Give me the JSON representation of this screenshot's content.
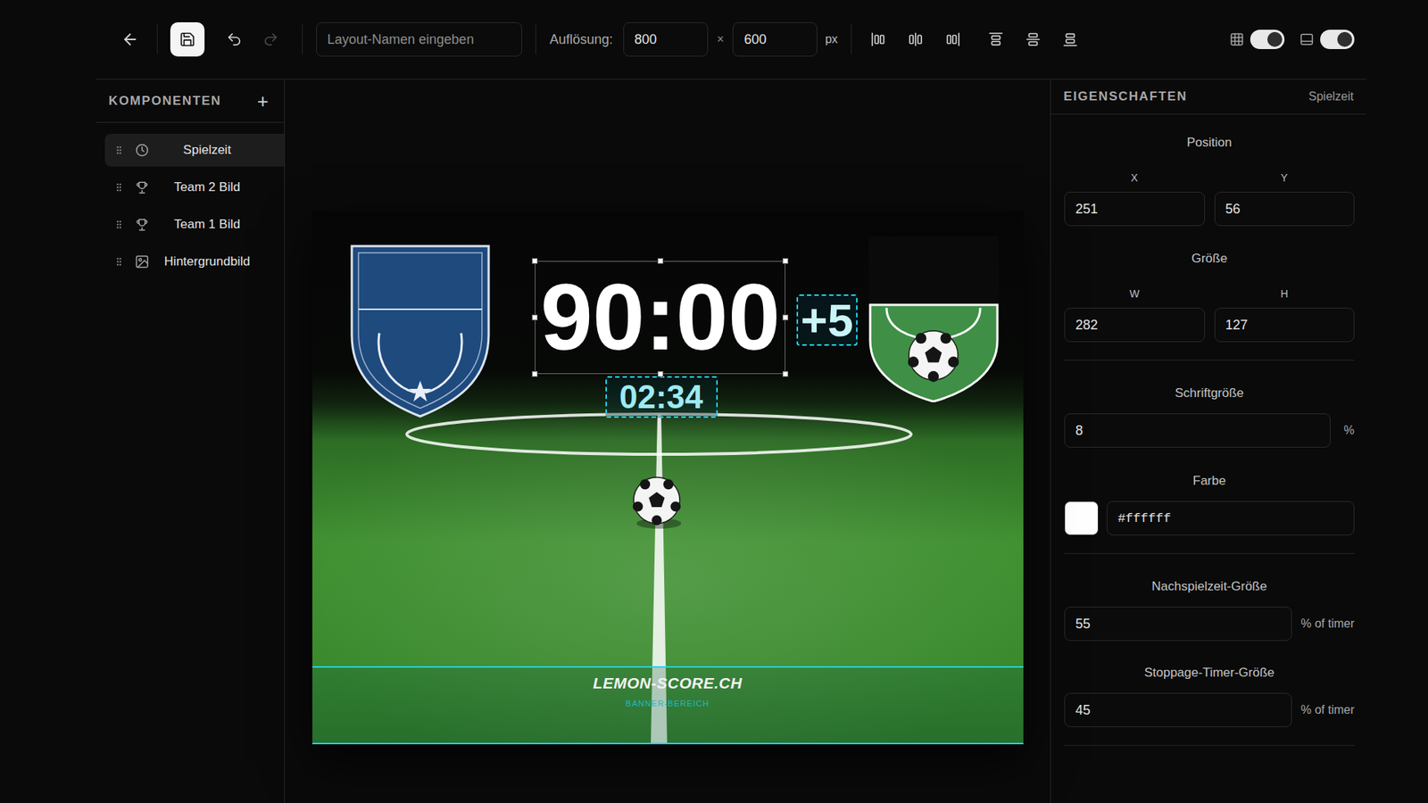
{
  "toolbar": {
    "layout_name": {
      "placeholder": "Layout-Namen eingeben"
    },
    "resolution_label": "Auflösung:",
    "width": "800",
    "times": "×",
    "height": "600",
    "unit": "px",
    "undo": {
      "disabled": false
    },
    "redo": {
      "disabled": true
    },
    "toggles": [
      {
        "kind": "grid",
        "on": true
      },
      {
        "kind": "banner",
        "on": true
      }
    ]
  },
  "components": {
    "title": "KOMPONENTEN",
    "add": "+",
    "items": [
      {
        "label": "Spielzeit",
        "kind": "timer",
        "selected": true
      },
      {
        "label": "Team 2 Bild",
        "kind": "team",
        "selected": false
      },
      {
        "label": "Team 1 Bild",
        "kind": "team",
        "selected": false
      },
      {
        "label": "Hintergrundbild",
        "kind": "image",
        "selected": false
      }
    ]
  },
  "canvas": {
    "timer": {
      "text": "90:00",
      "selected": true
    },
    "added_time": "+5",
    "stoppage_timer": "02:34",
    "banner": {
      "title": "LEMON-SCORE.CH",
      "label": "BANNER-BEREICH"
    }
  },
  "properties": {
    "title": "EIGENSCHAFTEN",
    "subject": "Spielzeit",
    "position": {
      "label": "Position",
      "x_label": "X",
      "x": "251",
      "y_label": "Y",
      "y": "56"
    },
    "size": {
      "label": "Größe",
      "w_label": "W",
      "w": "282",
      "h_label": "H",
      "h": "127"
    },
    "font_size": {
      "label": "Schriftgröße",
      "value": "8",
      "unit": "%"
    },
    "color": {
      "label": "Farbe",
      "value": "#ffffff",
      "color": "#ffffff"
    },
    "added_time_size": {
      "label": "Nachspielzeit-Größe",
      "value": "55",
      "unit": "% of timer"
    },
    "stoppage_size": {
      "label": "Stoppage-Timer-Größe",
      "value": "45",
      "unit": "% of timer"
    }
  }
}
